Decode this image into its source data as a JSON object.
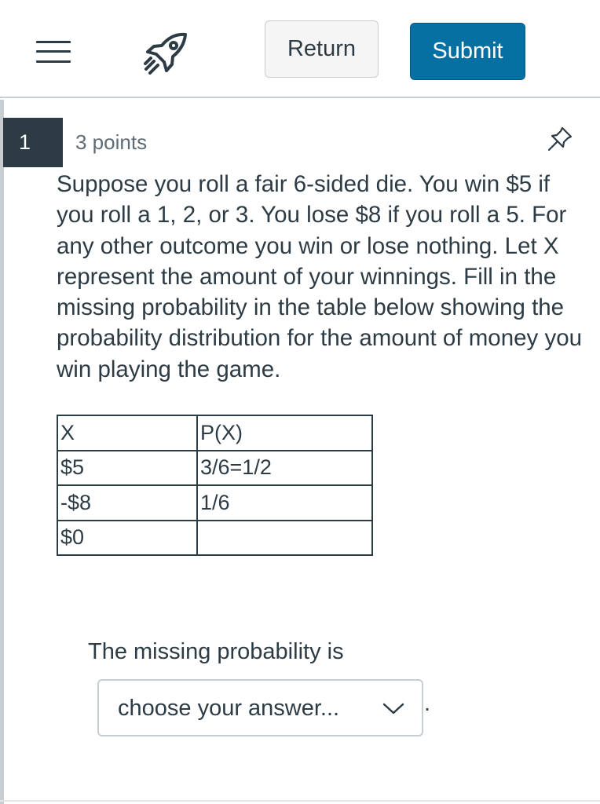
{
  "header": {
    "menu_icon": "hamburger-menu-icon",
    "rocket_icon": "rocket-icon",
    "return_label": "Return",
    "submit_label": "Submit",
    "submit_color": "#0770a3"
  },
  "question": {
    "number": "1",
    "points": "3 points",
    "pin_icon": "pin-icon",
    "text": "Suppose you roll a fair 6-sided die.  You win $5 if you roll a 1, 2, or 3.  You lose $8 if you roll a 5.  For any other outcome you win or lose nothing.  Let  X represent the amount of your winnings.  Fill in the missing probability in the table below showing the probability distribution for the amount of money you win playing the game."
  },
  "table": {
    "headers": [
      "X",
      "P(X)"
    ],
    "rows": [
      [
        "$5",
        "3/6=1/2"
      ],
      [
        "-$8",
        "1/6"
      ],
      [
        "$0",
        ""
      ]
    ]
  },
  "answer": {
    "prompt": "The missing probability is",
    "select_value": "choose your answer...",
    "chevron_icon": "chevron-down-icon",
    "trailing": "."
  }
}
